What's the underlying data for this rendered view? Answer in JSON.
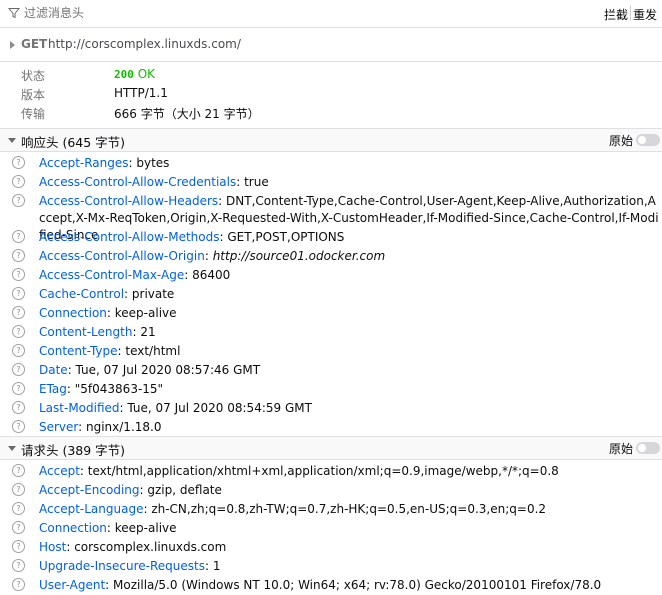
{
  "toolbar": {
    "filter_placeholder": "过滤消息头",
    "block_label": "拦截",
    "resend_label": "重发"
  },
  "request": {
    "method": "GET",
    "url": "http://corscomplex.linuxds.com/"
  },
  "summary": {
    "status_label": "状态",
    "status_code": "200",
    "status_text": "OK",
    "version_label": "版本",
    "version_value": "HTTP/1.1",
    "transfer_label": "传输",
    "transfer_value": "666 字节（大小 21 字节）"
  },
  "response_headers": {
    "title": "响应头 (645 字节)",
    "raw_label": "原始",
    "items": [
      {
        "name": "Accept-Ranges",
        "value": "bytes"
      },
      {
        "name": "Access-Control-Allow-Credentials",
        "value": "true"
      },
      {
        "name": "Access-Control-Allow-Headers",
        "value": "DNT,Content-Type,Cache-Control,User-Agent,Keep-Alive,Authorization,Accept,X-Mx-ReqToken,Origin,X-Requested-With,X-CustomHeader,If-Modified-Since,Cache-Control,If-Modified-Since"
      },
      {
        "name": "Access-Control-Allow-Methods",
        "value": "GET,POST,OPTIONS"
      },
      {
        "name": "Access-Control-Allow-Origin",
        "value": "http://source01.odocker.com"
      },
      {
        "name": "Access-Control-Max-Age",
        "value": "86400"
      },
      {
        "name": "Cache-Control",
        "value": "private"
      },
      {
        "name": "Connection",
        "value": "keep-alive"
      },
      {
        "name": "Content-Length",
        "value": "21"
      },
      {
        "name": "Content-Type",
        "value": "text/html"
      },
      {
        "name": "Date",
        "value": "Tue, 07 Jul 2020 08:57:46 GMT"
      },
      {
        "name": "ETag",
        "value": "\"5f043863-15\""
      },
      {
        "name": "Last-Modified",
        "value": "Tue, 07 Jul 2020 08:54:59 GMT"
      },
      {
        "name": "Server",
        "value": "nginx/1.18.0"
      }
    ]
  },
  "request_headers": {
    "title": "请求头 (389 字节)",
    "raw_label": "原始",
    "items": [
      {
        "name": "Accept",
        "value": "text/html,application/xhtml+xml,application/xml;q=0.9,image/webp,*/*;q=0.8"
      },
      {
        "name": "Accept-Encoding",
        "value": "gzip, deflate"
      },
      {
        "name": "Accept-Language",
        "value": "zh-CN,zh;q=0.8,zh-TW;q=0.7,zh-HK;q=0.5,en-US;q=0.3,en;q=0.2"
      },
      {
        "name": "Connection",
        "value": "keep-alive"
      },
      {
        "name": "Host",
        "value": "corscomplex.linuxds.com"
      },
      {
        "name": "Upgrade-Insecure-Requests",
        "value": "1"
      },
      {
        "name": "User-Agent",
        "value": "Mozilla/5.0 (Windows NT 10.0; Win64; x64; rv:78.0) Gecko/20100101 Firefox/78.0"
      }
    ]
  },
  "icons": {
    "filter": "filter-icon",
    "help": "question-circle-icon",
    "expand": "triangle-right-icon",
    "collapse": "triangle-down-icon"
  },
  "colors": {
    "header_name": "#0060df",
    "status_ok": "#12bc00",
    "section_bg": "#f9f9fa"
  }
}
